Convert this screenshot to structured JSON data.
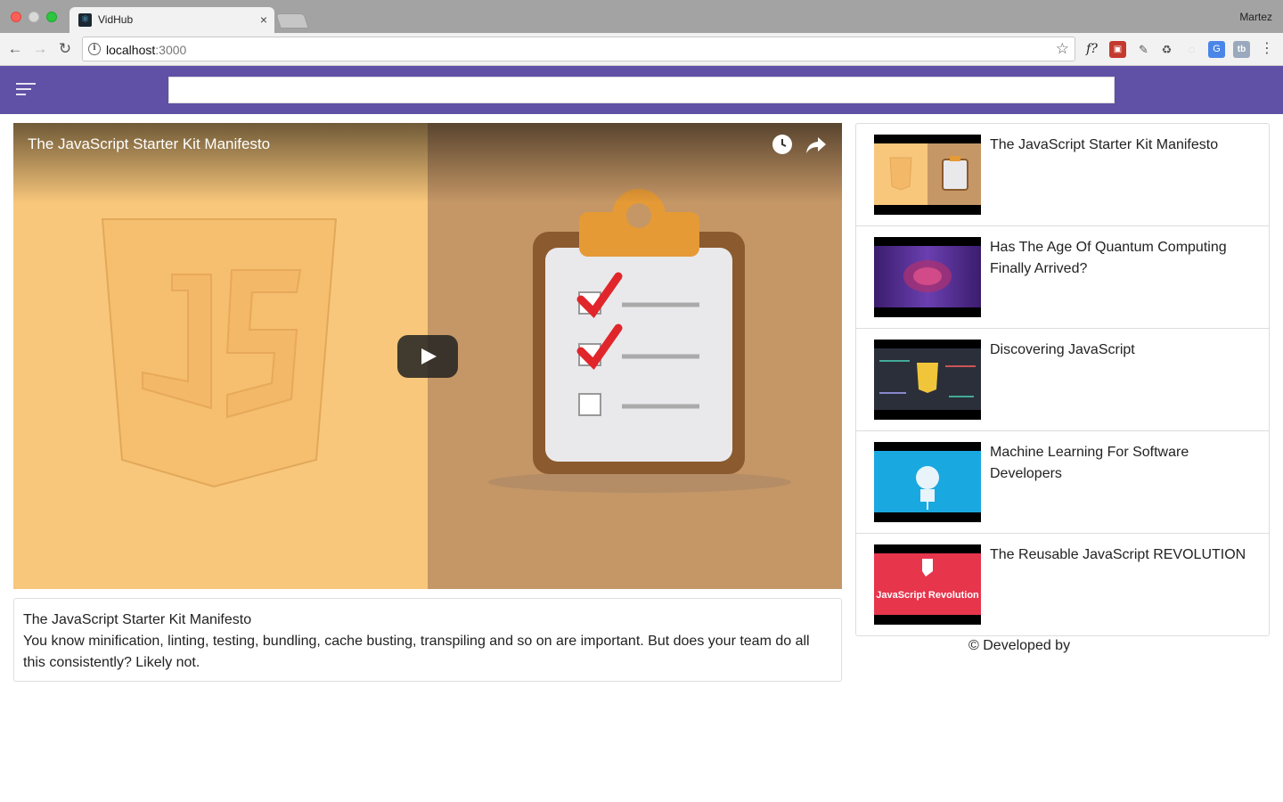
{
  "browser": {
    "tab_title": "VidHub",
    "tab_close": "×",
    "profile_name": "Martez",
    "url_host": "localhost",
    "url_port": ":3000",
    "back_label": "←",
    "forward_label": "→",
    "reload_label": "↻",
    "star_label": "☆",
    "menu_label": "⋮",
    "extensions": {
      "f": "f?",
      "red": "▣",
      "pen": "✎",
      "recycle": "♻",
      "circle": "◌",
      "translate": "G",
      "tb": "tb"
    }
  },
  "header": {
    "search_value": "",
    "accent_color": "#6050a6"
  },
  "player": {
    "title": "The JavaScript Starter Kit Manifesto"
  },
  "info": {
    "title": "The JavaScript Starter Kit Manifesto",
    "description": "You know minification, linting, testing, bundling, cache busting, transpiling and so on are important. But does your team do all this consistently? Likely not."
  },
  "videos": [
    {
      "title": "The JavaScript Starter Kit Manifesto"
    },
    {
      "title": "Has The Age Of Quantum Computing Finally Arrived?"
    },
    {
      "title": "Discovering JavaScript"
    },
    {
      "title": "Machine Learning For Software Developers"
    },
    {
      "title": "The Reusable JavaScript REVOLUTION",
      "thumb_text": "JavaScript Revolution"
    }
  ],
  "footer": {
    "text": "© Developed by"
  }
}
